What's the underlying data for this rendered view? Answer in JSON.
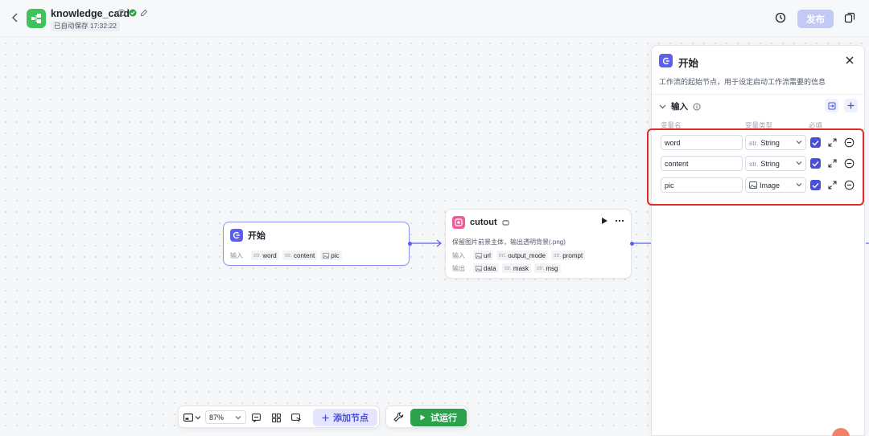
{
  "header": {
    "app_title": "knowledge_card",
    "autosave_text": "已自动保存 17:32:22",
    "publish_label": "发布"
  },
  "nodes": {
    "start": {
      "title": "开始",
      "inputs_label": "输入",
      "inputs": [
        {
          "type": "str.",
          "name": "word"
        },
        {
          "type": "str.",
          "name": "content"
        },
        {
          "type": "image",
          "name": "pic"
        }
      ]
    },
    "cutout": {
      "title": "cutout",
      "description": "保留图片前景主体，输出透明背景(.png)",
      "inputs_label": "输入",
      "inputs": [
        {
          "type": "image",
          "name": "url"
        },
        {
          "type": "int.",
          "name": "output_mode"
        },
        {
          "type": "str.",
          "name": "prompt"
        }
      ],
      "outputs_label": "输出",
      "outputs": [
        {
          "type": "image",
          "name": "data"
        },
        {
          "type": "str.",
          "name": "mask"
        },
        {
          "type": "str.",
          "name": "msg"
        }
      ]
    }
  },
  "toolbar": {
    "zoom_value": "87%",
    "add_node_label": "添加节点",
    "run_label": "试运行"
  },
  "panel": {
    "title": "开始",
    "description": "工作流的起始节点，用于设定启动工作流需要的信息",
    "section_title": "输入",
    "columns": {
      "name": "变量名",
      "type": "变量类型",
      "required": "必填"
    },
    "variables": [
      {
        "name": "word",
        "type_prefix": "str.",
        "type_label": "String",
        "required": true
      },
      {
        "name": "content",
        "type_prefix": "str.",
        "type_label": "String",
        "required": true
      },
      {
        "name": "pic",
        "type_prefix": "image",
        "type_label": "Image",
        "required": true
      }
    ]
  },
  "colors": {
    "accent": "#5b5ff0",
    "run_green": "#2aa14a",
    "highlight_red": "#e02b2b",
    "logo_green": "#3ec25a"
  }
}
